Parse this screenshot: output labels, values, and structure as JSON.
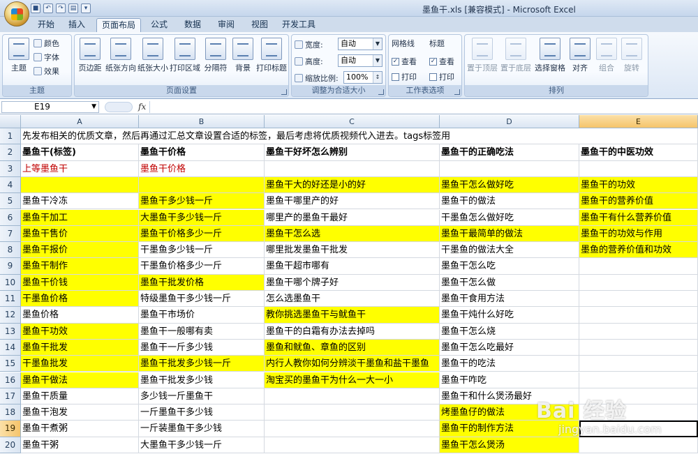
{
  "window": {
    "title": "墨鱼干.xls  [兼容模式] - Microsoft Excel"
  },
  "tabs": [
    "开始",
    "插入",
    "页面布局",
    "公式",
    "数据",
    "审阅",
    "视图",
    "开发工具"
  ],
  "active_tab": "页面布局",
  "ribbon": {
    "theme_group": {
      "label": "主题",
      "themes": "主题",
      "colors": "颜色",
      "fonts": "字体",
      "effects": "效果"
    },
    "page_setup_group": {
      "label": "页面设置",
      "buttons": [
        "页边距",
        "纸张方向",
        "纸张大小",
        "打印区域",
        "分隔符",
        "背景",
        "打印标题"
      ]
    },
    "scale_group": {
      "label": "调整为合适大小",
      "width_label": "宽度:",
      "width_value": "自动",
      "height_label": "高度:",
      "height_value": "自动",
      "scale_label": "缩放比例:",
      "scale_value": "100%"
    },
    "sheet_options_group": {
      "label": "工作表选项",
      "gridlines": "网格线",
      "headings": "标题",
      "view": "查看",
      "print": "打印"
    },
    "arrange_group": {
      "label": "排列",
      "buttons": [
        "置于顶层",
        "置于底层",
        "选择窗格",
        "对齐",
        "组合",
        "旋转"
      ]
    }
  },
  "formula_bar": {
    "name_box": "E19",
    "fx": "fx",
    "value": ""
  },
  "columns": [
    "A",
    "B",
    "C",
    "D",
    "E"
  ],
  "selected_column": "E",
  "selected_row": "19",
  "rows": [
    {
      "num": "1",
      "cells": [
        "先发布相关的优质文章，然后再通过汇总文章设置合适的标签，最后考虑将优质视频代入进去。tags标签用",
        "",
        "",
        "",
        ""
      ]
    },
    {
      "num": "2",
      "cells": [
        "墨鱼干(标签)",
        "墨鱼干价格",
        "墨鱼干好坏怎么辨别",
        "墨鱼干的正确吃法",
        "墨鱼干的中医功效"
      ]
    },
    {
      "num": "3",
      "cells": [
        "上等墨鱼干",
        "墨鱼干价格",
        "",
        "",
        ""
      ]
    },
    {
      "num": "4",
      "cells": [
        "",
        "",
        "墨鱼干大的好还是小的好",
        "墨鱼干怎么做好吃",
        "墨鱼干的功效"
      ]
    },
    {
      "num": "5",
      "cells": [
        "墨鱼干冷冻",
        "墨鱼干多少钱一斤",
        "墨鱼干哪里产的好",
        "墨鱼干的做法",
        "墨鱼干的营养价值"
      ]
    },
    {
      "num": "6",
      "cells": [
        "墨鱼干加工",
        "大墨鱼干多少钱一斤",
        "哪里产的墨鱼干最好",
        "干墨鱼怎么做好吃",
        "墨鱼干有什么营养价值"
      ]
    },
    {
      "num": "7",
      "cells": [
        "墨鱼干售价",
        "墨鱼干价格多少一斤",
        "墨鱼干怎么选",
        "墨鱼干最简单的做法",
        "墨鱼干的功效与作用"
      ]
    },
    {
      "num": "8",
      "cells": [
        "墨鱼干报价",
        "干墨鱼多少钱一斤",
        "哪里批发墨鱼干批发",
        "干墨鱼的做法大全",
        "墨鱼的营养价值和功效"
      ]
    },
    {
      "num": "9",
      "cells": [
        "墨鱼干制作",
        "干墨鱼价格多少一斤",
        "墨鱼干超市哪有",
        "墨鱼干怎么吃",
        ""
      ]
    },
    {
      "num": "10",
      "cells": [
        "墨鱼干价钱",
        "墨鱼干批发价格",
        "墨鱼干哪个牌子好",
        "墨鱼干怎么做",
        ""
      ]
    },
    {
      "num": "11",
      "cells": [
        "干墨鱼价格",
        "特级墨鱼干多少钱一斤",
        "怎么选墨鱼干",
        "墨鱼干食用方法",
        ""
      ]
    },
    {
      "num": "12",
      "cells": [
        "墨鱼价格",
        "墨鱼干市场价",
        "教你挑选墨鱼干与鱿鱼干",
        "墨鱼干炖什么好吃",
        ""
      ]
    },
    {
      "num": "13",
      "cells": [
        "墨鱼干功效",
        "墨鱼干一般哪有卖",
        "墨鱼干的白霜有办法去掉吗",
        "墨鱼干怎么烧",
        ""
      ]
    },
    {
      "num": "14",
      "cells": [
        "墨鱼干批发",
        "墨鱼干一斤多少钱",
        "墨鱼和鱿鱼、章鱼的区别",
        "墨鱼干怎么吃最好",
        ""
      ]
    },
    {
      "num": "15",
      "cells": [
        "干墨鱼批发",
        "墨鱼干批发多少钱一斤",
        "内行人教你如何分辨淡干墨鱼和盐干墨鱼",
        "墨鱼干的吃法",
        ""
      ]
    },
    {
      "num": "16",
      "cells": [
        "墨鱼干做法",
        "墨鱼干批发多少钱",
        "淘宝买的墨鱼干为什么一大一小",
        "墨鱼干咋吃",
        ""
      ]
    },
    {
      "num": "17",
      "cells": [
        "墨鱼干质量",
        "多少钱一斤墨鱼干",
        "",
        "墨鱼干和什么煲汤最好",
        ""
      ]
    },
    {
      "num": "18",
      "cells": [
        "墨鱼干泡发",
        "一斤墨鱼干多少钱",
        "",
        "烤墨鱼仔的做法",
        ""
      ]
    },
    {
      "num": "19",
      "cells": [
        "墨鱼干煮粥",
        "一斤装墨鱼干多少钱",
        "",
        "墨鱼干的制作方法",
        ""
      ]
    },
    {
      "num": "20",
      "cells": [
        "墨鱼干粥",
        "大墨鱼干多少钱一斤",
        "",
        "墨鱼干怎么煲汤",
        ""
      ]
    }
  ],
  "highlight_color": "#ffff00",
  "header_red_color": "#c00000",
  "watermark": {
    "brand": "Bai 经验",
    "url": "jingyan.baidu.com"
  }
}
